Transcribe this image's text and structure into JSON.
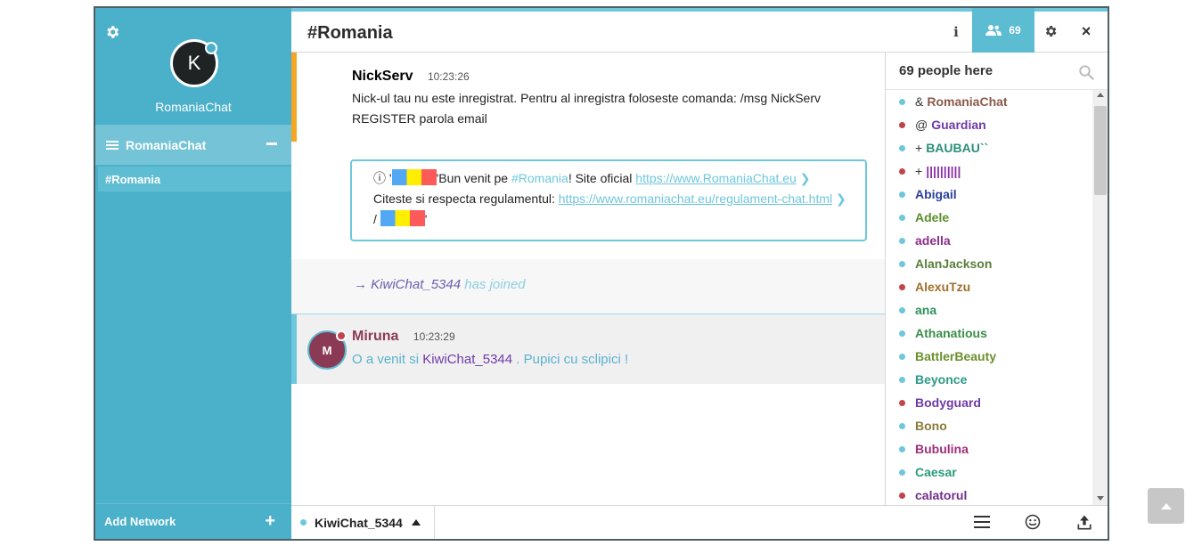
{
  "sidebar": {
    "avatar_letter": "K",
    "nick": "RomaniaChat",
    "network_name": "RomaniaChat",
    "channel": "#Romania",
    "add_network_label": "Add Network"
  },
  "header": {
    "channel_title": "#Romania",
    "info_label": "i",
    "user_count": "69",
    "close_label": "×"
  },
  "messages": {
    "nickserv": {
      "nick": "NickServ",
      "time": "10:23:26",
      "text": "Nick-ul tau nu este inregistrat. Pentru al inregistra foloseste comanda: /msg NickServ REGISTER parola email"
    },
    "motd": {
      "info_glyph": "ⓘ",
      "quote_open": "'",
      "welcome": "'Bun venit pe ",
      "channel_link": "#Romania",
      "site_text": "! Site oficial ",
      "site_url": "https://www.RomaniaChat.eu",
      "rules_text": "Citeste si respecta regulamentul: ",
      "rules_url": "https://www.romaniachat.eu/regulament-chat.html",
      "slash": " / ",
      "quote_close": "'"
    },
    "join": {
      "arrow": "→",
      "nick": "KiwiChat_5344",
      "action": "has joined"
    },
    "miruna": {
      "avatar_letter": "M",
      "nick": "Miruna",
      "time": "10:23:29",
      "text_before": "O a venit si ",
      "mention": "KiwiChat_5344",
      "text_after": " . Pupici cu sclipici !"
    }
  },
  "nicklist": {
    "count_label": "69 people here",
    "items": [
      {
        "prefix": "&",
        "nick": "RomaniaChat",
        "color": "#8b5a4a",
        "dot": "#6ec7dc"
      },
      {
        "prefix": "@",
        "nick": "Guardian",
        "color": "#6e3aa8",
        "dot": "#c0444a"
      },
      {
        "prefix": "+",
        "nick": "BAUBAU``",
        "color": "#2b8f7b",
        "dot": "#6ec7dc"
      },
      {
        "prefix": "+",
        "nick": "||||||||||",
        "color": "#8b2fa8",
        "dot": "#c0444a"
      },
      {
        "prefix": "",
        "nick": "Abigail",
        "color": "#2b3f9a",
        "dot": "#6ec7dc"
      },
      {
        "prefix": "",
        "nick": "Adele",
        "color": "#5a8f2b",
        "dot": "#6ec7dc"
      },
      {
        "prefix": "",
        "nick": "adella",
        "color": "#8b2f8b",
        "dot": "#6ec7dc"
      },
      {
        "prefix": "",
        "nick": "AlanJackson",
        "color": "#5a7f3a",
        "dot": "#6ec7dc"
      },
      {
        "prefix": "",
        "nick": "AlexuTzu",
        "color": "#a0702a",
        "dot": "#c0444a"
      },
      {
        "prefix": "",
        "nick": "ana",
        "color": "#2b8f5a",
        "dot": "#6ec7dc"
      },
      {
        "prefix": "",
        "nick": "Athanatious",
        "color": "#3a8f4a",
        "dot": "#6ec7dc"
      },
      {
        "prefix": "",
        "nick": "BattlerBeauty",
        "color": "#6a8f2b",
        "dot": "#6ec7dc"
      },
      {
        "prefix": "",
        "nick": "Beyonce",
        "color": "#2b9a8a",
        "dot": "#6ec7dc"
      },
      {
        "prefix": "",
        "nick": "Bodyguard",
        "color": "#6e3aa8",
        "dot": "#c0444a"
      },
      {
        "prefix": "",
        "nick": "Bono",
        "color": "#8a7a3a",
        "dot": "#6ec7dc"
      },
      {
        "prefix": "",
        "nick": "Bubulina",
        "color": "#a02f7a",
        "dot": "#6ec7dc"
      },
      {
        "prefix": "",
        "nick": "Caesar",
        "color": "#2b9a7a",
        "dot": "#6ec7dc"
      },
      {
        "prefix": "",
        "nick": "calatorul",
        "color": "#6e2f8b",
        "dot": "#c0444a"
      }
    ]
  },
  "input": {
    "nick": "KiwiChat_5344",
    "placeholder": ""
  },
  "colors": {
    "sidebar": "#4bb0c9",
    "accent": "#6ec7dc",
    "highlight": "#f5a623"
  }
}
